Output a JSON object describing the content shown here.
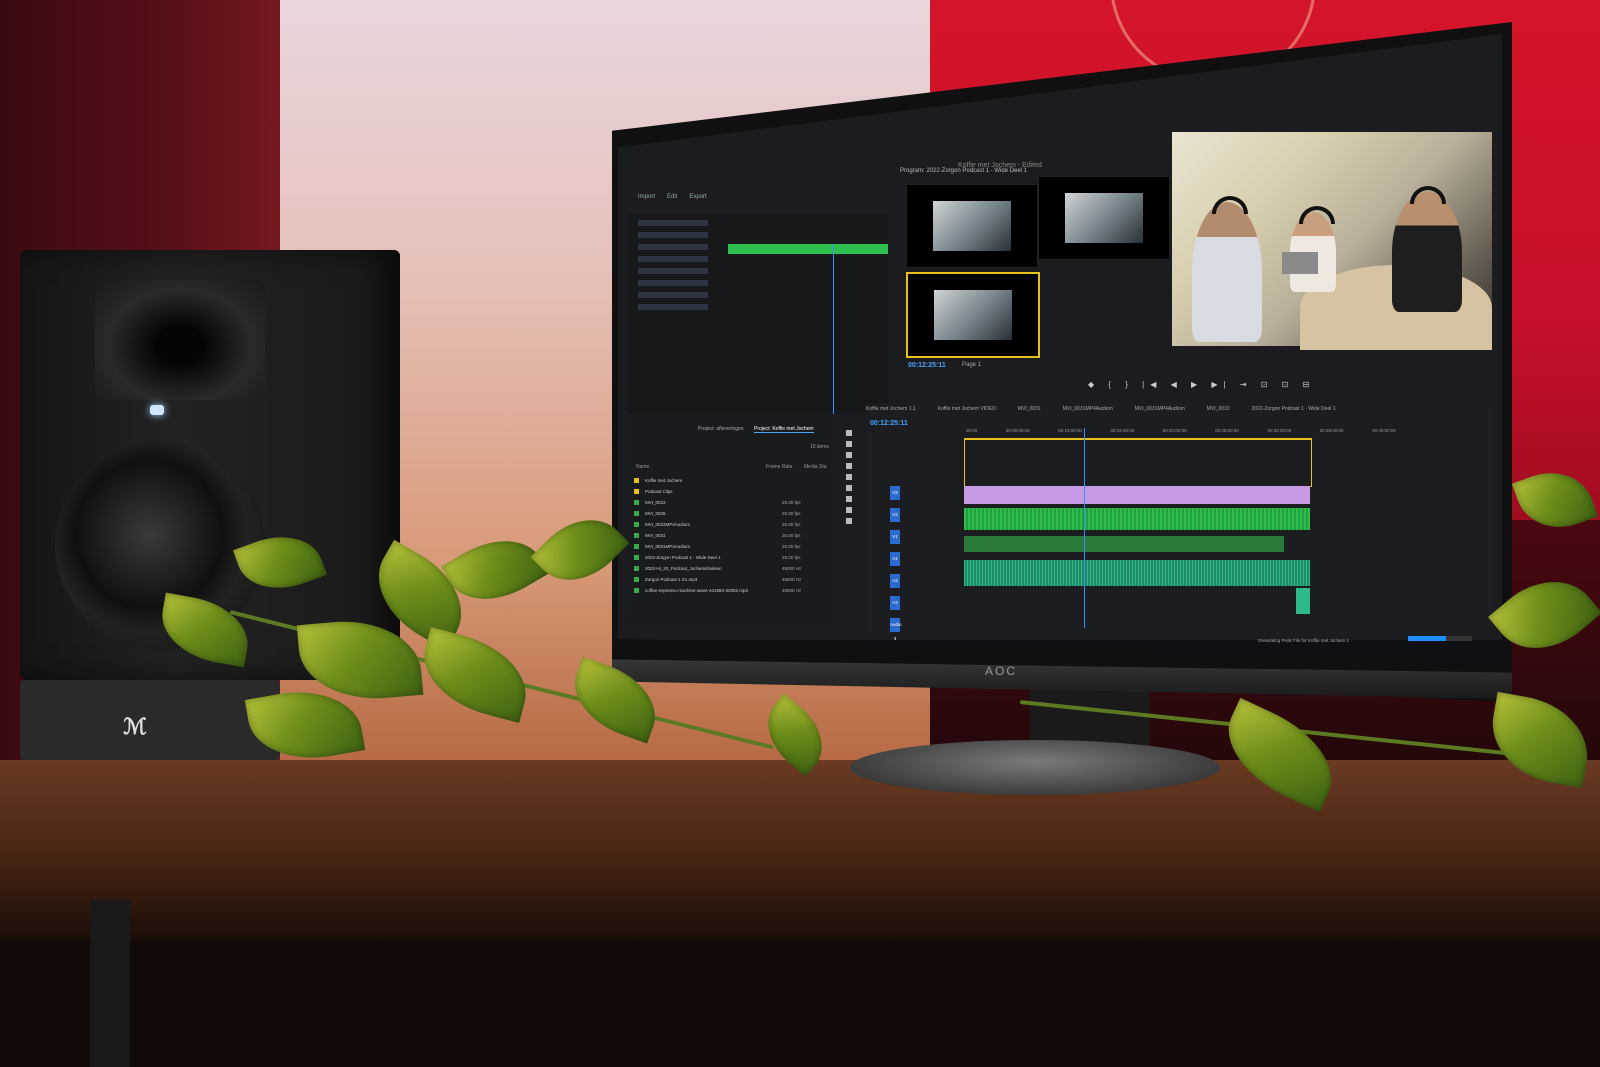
{
  "monitor": {
    "brand": "AOC"
  },
  "premiere": {
    "window_title": "Koffie met Jochem - Edited",
    "workspace_tabs": [
      "Import",
      "Edit",
      "Export"
    ],
    "program_monitor_title": "Program: 2022-Zorgon Podcast 1 - Wide Deel 1",
    "program_timecode": "00:12:25:11",
    "program_page": "Page 1",
    "transport_controls": "◆ { } |◀ ◀ ▶ ▶| ⇥ ⊡ ⊡ ⊟",
    "project_tabs": [
      "Project: Koffie met Jochem",
      "Project: afleveringen"
    ],
    "project_items": [
      {
        "name": "Koffie met Jochem",
        "fps": "",
        "color": "#e8c21a"
      },
      {
        "name": "Podcast Clips",
        "fps": "",
        "color": "#e8c21a"
      },
      {
        "name": "MVI_0022",
        "fps": "25.00 fps",
        "color": "#3aa84a"
      },
      {
        "name": "MVI_0025",
        "fps": "25.00 fps",
        "color": "#3aa84a"
      },
      {
        "name": "MVI_0022MP4Audiom",
        "fps": "25.00 fps",
        "color": "#3aa84a"
      },
      {
        "name": "MVI_0031",
        "fps": "25.00 fps",
        "color": "#3aa84a"
      },
      {
        "name": "MVI_0031MP4Audiom",
        "fps": "25.00 fps",
        "color": "#3aa84a"
      },
      {
        "name": "2022-Zorgon Podcast 1 - Wide Deel 1",
        "fps": "25.00 fps",
        "color": "#3aa84a"
      },
      {
        "name": "2022-Hi_20_Podcast_JochemKlanken",
        "fps": "48000 Hz",
        "color": "#3aa84a"
      },
      {
        "name": "Zorgon Podcast 1 S1.mp3",
        "fps": "48000 Hz",
        "color": "#3aa84a"
      },
      {
        "name": "coffee-espresso-machine-wave-441884-32002.mp3",
        "fps": "48000 Hz",
        "color": "#3aa84a"
      }
    ],
    "project_count": "10 items",
    "project_headers": {
      "name": "Name",
      "fps": "Frame Rate",
      "media": "Media Sta"
    },
    "sequence_tabs": [
      "Koffie met Jochem 1.1",
      "Koffie met Jochem VIDEO",
      "MVI_0031",
      "MVI_0031MP4Audiom",
      "MVI_0031MP4Audiom",
      "MVI_0010",
      "2022-Zorgon Podcast 1 - Wide Deel 1"
    ],
    "timeline_timecode": "00:12:25:11",
    "ruler": [
      "00:00",
      "00:05:00:00",
      "00:10:00:00",
      "00:15:00:00",
      "00:20:00:00",
      "00:25:00:00",
      "00:30:00:00",
      "00:35:00:00",
      "00:40:00:00"
    ],
    "tracks": [
      "V3",
      "V2",
      "V1",
      "A1",
      "A2",
      "A3",
      "Audio 3"
    ],
    "status_text": "Generating Peak File for Koffie met Jochem 1",
    "render_progress": 0.6
  },
  "colors": {
    "accent_blue": "#4aa3ff",
    "clip_green": "#2fbf4f",
    "clip_purple": "#c79ae6",
    "audio_teal": "#2fb88a",
    "in_out_yellow": "#e8c21a"
  }
}
